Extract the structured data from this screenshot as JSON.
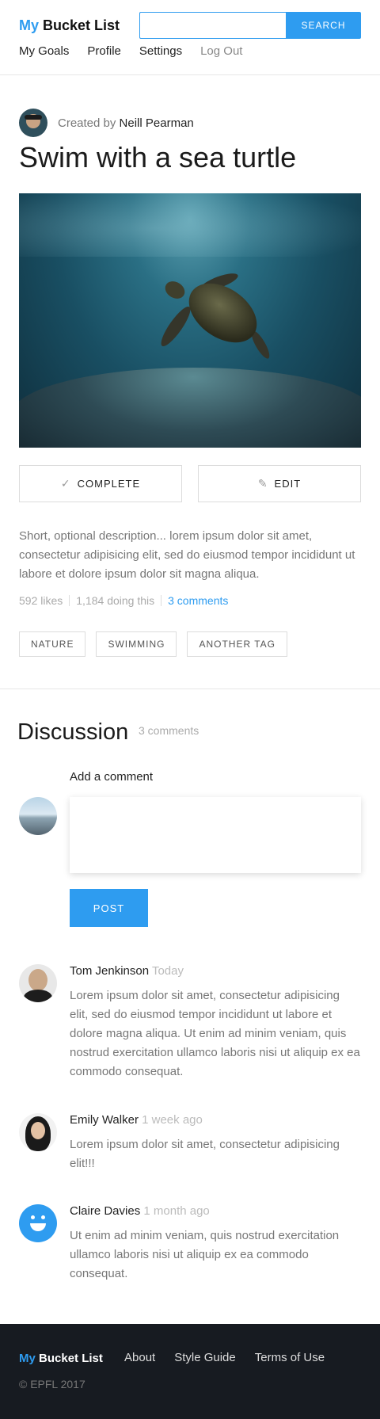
{
  "header": {
    "logo_my": "My",
    "logo_rest": "Bucket List",
    "search": {
      "value": "",
      "placeholder": "",
      "button_label": "SEARCH"
    },
    "nav": [
      "My Goals",
      "Profile",
      "Settings",
      "Log Out"
    ]
  },
  "goal": {
    "created_by_prefix": "Created by",
    "creator_name": "Neill Pearman",
    "title": "Swim with a sea turtle",
    "complete_label": "COMPLETE",
    "edit_label": "EDIT",
    "description": "Short, optional description... lorem ipsum dolor sit amet, consectetur adipisicing elit, sed do eiusmod tempor incididunt ut labore et dolore ipsum dolor sit magna aliqua.",
    "likes": "592 likes",
    "doing": "1,184 doing this",
    "comments_link": "3 comments",
    "tags": [
      "NATURE",
      "SWIMMING",
      "ANOTHER TAG"
    ]
  },
  "discussion": {
    "title": "Discussion",
    "count": "3 comments",
    "add_label": "Add a comment",
    "comment_value": "",
    "post_label": "POST",
    "comments": [
      {
        "author": "Tom Jenkinson",
        "time": "Today",
        "body": "Lorem ipsum dolor sit amet, consectetur adipisicing elit, sed do eiusmod tempor incididunt ut labore et dolore magna aliqua. Ut enim ad minim veniam, quis nostrud exercitation ullamco laboris nisi ut aliquip ex ea commodo consequat."
      },
      {
        "author": "Emily Walker",
        "time": "1 week ago",
        "body": "Lorem ipsum dolor sit amet, consectetur adipisicing elit!!!"
      },
      {
        "author": "Claire Davies",
        "time": "1 month ago",
        "body": "Ut enim ad minim veniam, quis nostrud exercitation ullamco laboris nisi ut aliquip ex ea commodo consequat."
      }
    ]
  },
  "footer": {
    "logo_my": "My",
    "logo_rest": "Bucket List",
    "links": [
      "About",
      "Style Guide",
      "Terms of Use"
    ],
    "copyright": "© EPFL 2017"
  },
  "colors": {
    "accent": "#2e9cf0",
    "footer_bg": "#171b21",
    "muted_text": "#777777"
  },
  "icons": {
    "complete": "check-icon",
    "edit": "pencil-icon"
  }
}
